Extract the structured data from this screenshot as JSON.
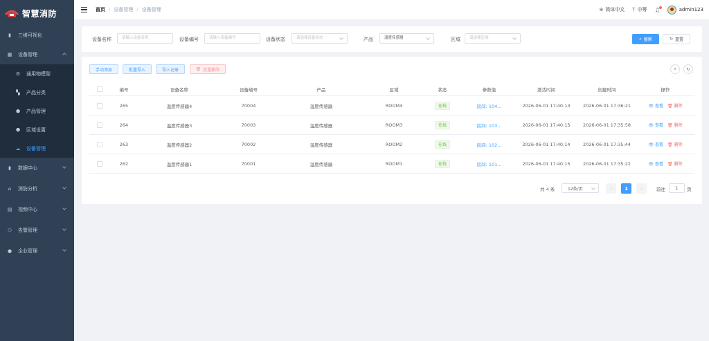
{
  "app": {
    "title": "智慧消防"
  },
  "sidebar": {
    "items": [
      {
        "label": "三维可视化",
        "icon": "chart-icon"
      },
      {
        "label": "设备管理",
        "icon": "grid-icon",
        "expanded": true
      },
      {
        "label": "数据中心",
        "icon": "chart-icon"
      },
      {
        "label": "消防分析",
        "icon": "home-icon"
      },
      {
        "label": "视频中心",
        "icon": "monitor-icon"
      },
      {
        "label": "告警管理",
        "icon": "user-group-icon"
      },
      {
        "label": "企业管理",
        "icon": "building-icon"
      }
    ],
    "sub_items": [
      {
        "label": "通用物模型"
      },
      {
        "label": "产品分类"
      },
      {
        "label": "产品管理"
      },
      {
        "label": "区域设置"
      },
      {
        "label": "设备管理",
        "active": true
      }
    ]
  },
  "header": {
    "breadcrumb": [
      "首页",
      "设备管理",
      "设备管理"
    ],
    "lang_label": "简体中文",
    "size_label": "中等",
    "username": "admin123"
  },
  "filter": {
    "name_label": "设备名称",
    "name_placeholder": "请输入设备名称",
    "code_label": "设备编号",
    "code_placeholder": "请输入设备编号",
    "status_label": "设备状态",
    "status_placeholder": "请选择设备状态",
    "product_label": "产品",
    "product_value": "温度传感器",
    "area_label": "区域",
    "area_placeholder": "请选择区域",
    "search_label": "搜索",
    "reset_label": "重置"
  },
  "toolbar": {
    "add_label": "手动添加",
    "batch_import_label": "批量导入",
    "import_record_label": "导入记录",
    "batch_delete_label": "批量删除"
  },
  "table": {
    "columns": [
      "编号",
      "设备名称",
      "设备编号",
      "产品",
      "区域",
      "状态",
      "参数值",
      "激活时间",
      "创建时间",
      "操作"
    ],
    "rows": [
      {
        "id": "265",
        "name": "温度传感器4",
        "code": "70004",
        "product": "温度传感器",
        "area": "ROOM4",
        "status": "在线",
        "param": "房间: 104...",
        "activated": "2026-06-01 17:40:13",
        "created": "2026-06-01 17:36:21",
        "view": "查看",
        "delete": "删除"
      },
      {
        "id": "264",
        "name": "温度传感器3",
        "code": "70003",
        "product": "温度传感器",
        "area": "ROOM3",
        "status": "在线",
        "param": "房间: 103...",
        "activated": "2026-06-01 17:40:15",
        "created": "2026-06-01 17:35:58",
        "view": "查看",
        "delete": "删除"
      },
      {
        "id": "263",
        "name": "温度传感器2",
        "code": "70002",
        "product": "温度传感器",
        "area": "ROOM2",
        "status": "在线",
        "param": "房间: 102...",
        "activated": "2026-06-01 17:40:14",
        "created": "2026-06-01 17:35:44",
        "view": "查看",
        "delete": "删除"
      },
      {
        "id": "262",
        "name": "温度传感器1",
        "code": "70001",
        "product": "温度传感器",
        "area": "ROOM1",
        "status": "在线",
        "param": "房间: 101...",
        "activated": "2026-06-01 17:40:15",
        "created": "2026-06-01 17:35:22",
        "view": "查看",
        "delete": "删除"
      }
    ]
  },
  "pagination": {
    "total_label": "共 4 条",
    "page_size": "12条/页",
    "current_page": "1",
    "goto_label": "前往",
    "goto_value": "1",
    "page_suffix": "页"
  },
  "colors": {
    "sidebar_bg": "#304156",
    "accent": "#409eff",
    "danger": "#f56c6c",
    "success": "#67c23a"
  }
}
